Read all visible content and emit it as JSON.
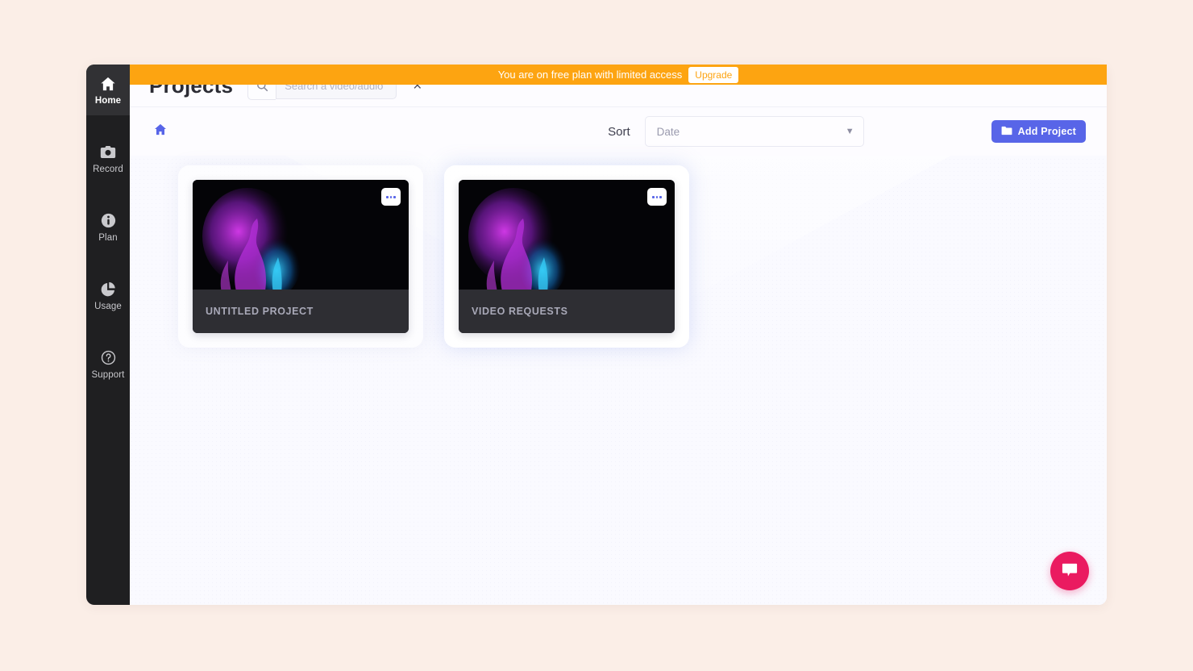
{
  "banner": {
    "message": "You are on free plan with limited access",
    "upgrade_label": "Upgrade",
    "bg_color": "#fda411"
  },
  "sidebar": {
    "items": [
      {
        "label": "Home",
        "icon": "home-icon",
        "active": true
      },
      {
        "label": "Record",
        "icon": "camera-icon",
        "active": false
      },
      {
        "label": "Plan",
        "icon": "info-icon",
        "active": false
      },
      {
        "label": "Usage",
        "icon": "pie-chart-icon",
        "active": false
      },
      {
        "label": "Support",
        "icon": "help-icon",
        "active": false
      }
    ]
  },
  "header": {
    "title": "Projects",
    "search_placeholder": "Search a video/audio",
    "search_value": "",
    "clear_label": "×",
    "search_icon": "search-icon"
  },
  "toolbar": {
    "breadcrumb_icon": "home-icon",
    "sort_label": "Sort",
    "sort_value": "Date",
    "sort_options": [
      "Date"
    ],
    "add_project_label": "Add Project",
    "add_project_icon": "folder-icon",
    "accent_color": "#5865e8"
  },
  "projects": [
    {
      "name": "UNTITLED PROJECT",
      "menu_label": "•••",
      "selected": false
    },
    {
      "name": "VIDEO REQUESTS",
      "menu_label": "•••",
      "selected": true
    }
  ],
  "chat": {
    "icon": "chat-bubble-icon",
    "color": "#ea1a60"
  }
}
